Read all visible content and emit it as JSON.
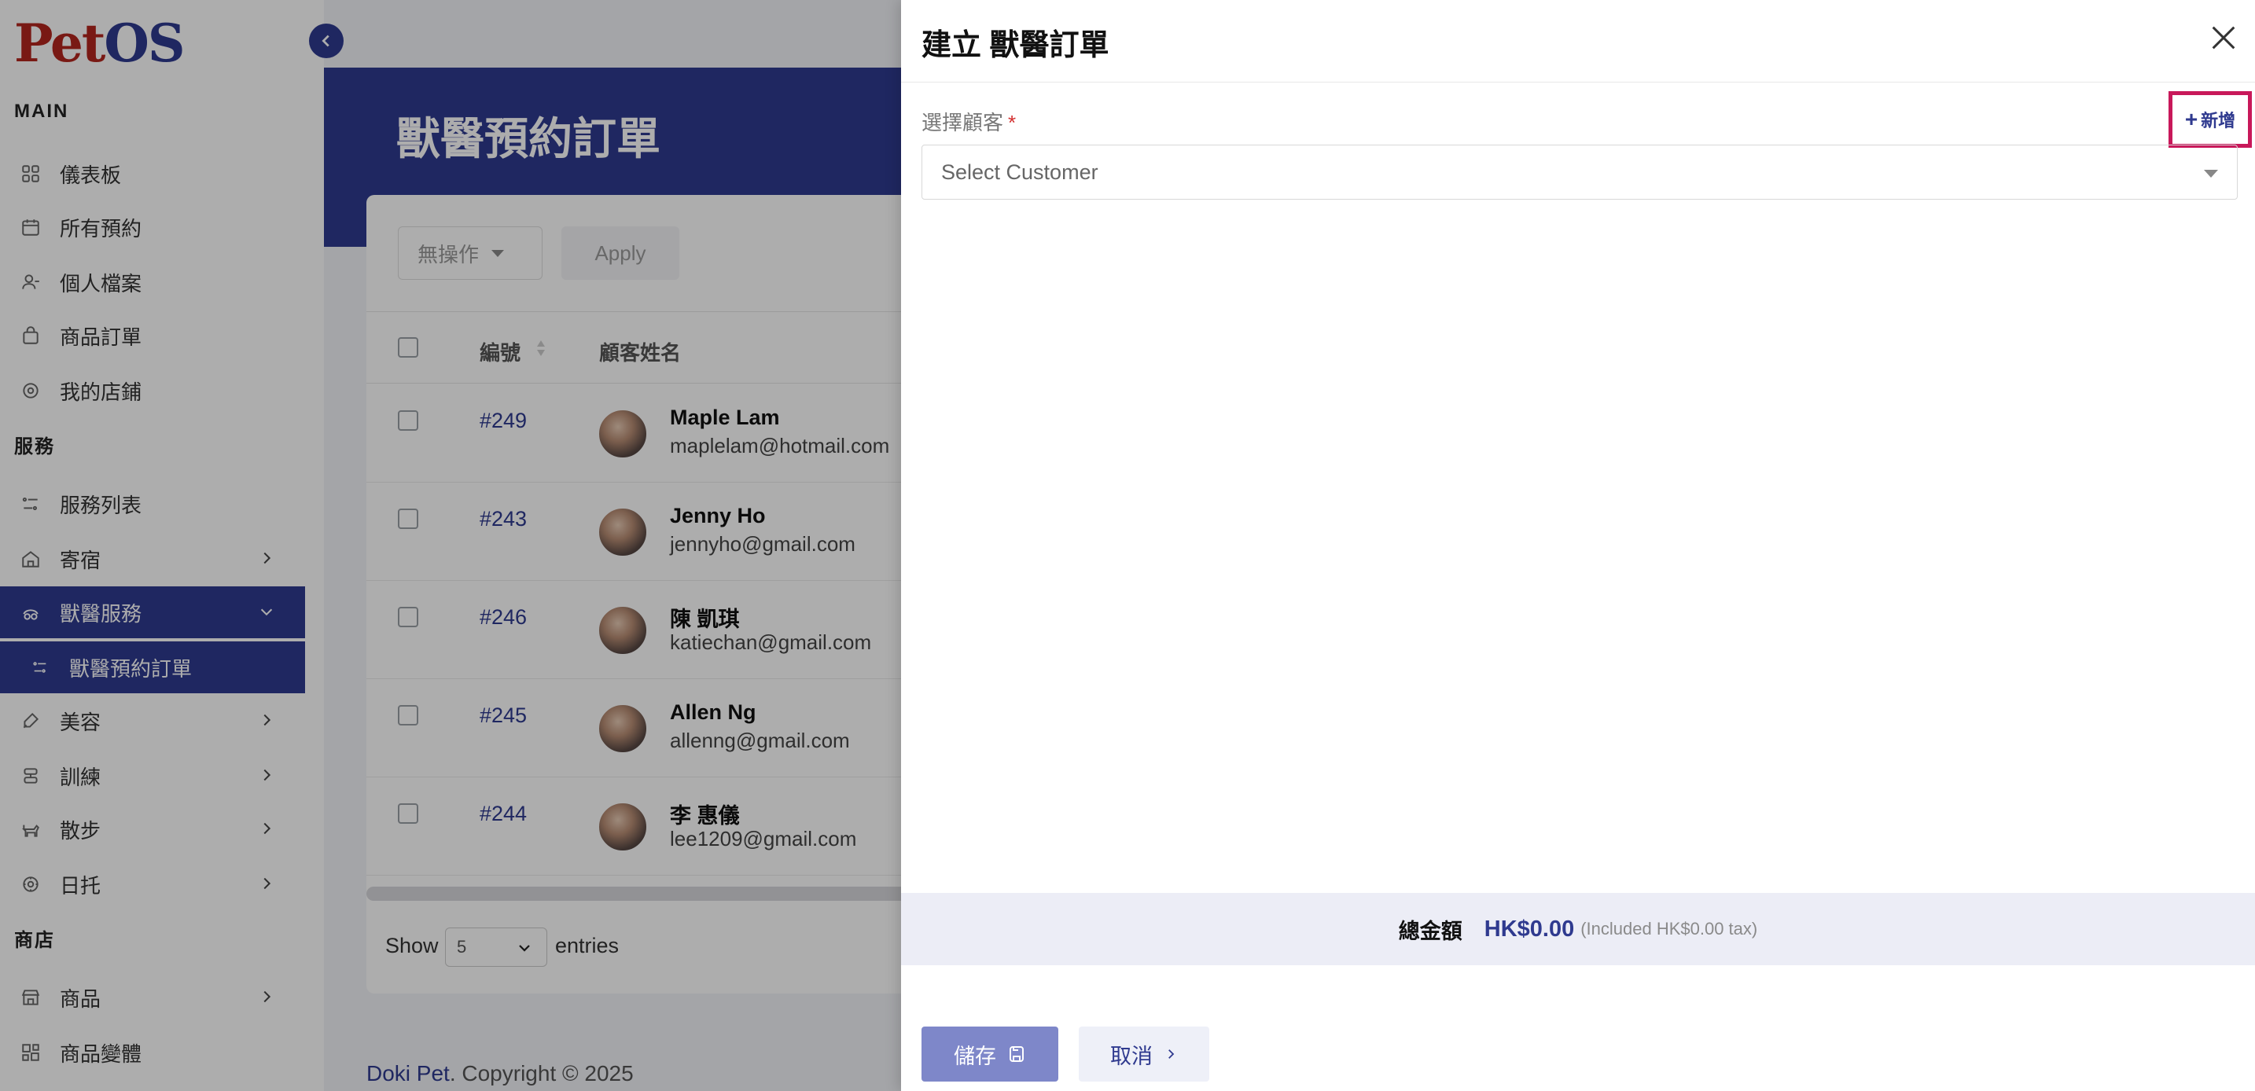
{
  "sidebar": {
    "logo_pet": "Pet",
    "logo_os": "OS",
    "sections": {
      "main": "MAIN",
      "services": "服務",
      "shop": "商店"
    },
    "items": [
      {
        "label": "儀表板",
        "icon": "dashboard-icon"
      },
      {
        "label": "所有預約",
        "icon": "calendar-icon"
      },
      {
        "label": "個人檔案",
        "icon": "user-icon"
      },
      {
        "label": "商品訂單",
        "icon": "bag-icon"
      },
      {
        "label": "我的店鋪",
        "icon": "store-icon"
      },
      {
        "label": "服務列表",
        "icon": "list-icon"
      },
      {
        "label": "寄宿",
        "icon": "home-icon"
      },
      {
        "label": "獸醫服務",
        "icon": "vet-icon"
      },
      {
        "label": "獸醫預約訂單",
        "icon": "list-icon"
      },
      {
        "label": "美容",
        "icon": "brush-icon"
      },
      {
        "label": "訓練",
        "icon": "training-icon"
      },
      {
        "label": "散步",
        "icon": "dog-icon"
      },
      {
        "label": "日托",
        "icon": "daycare-icon"
      },
      {
        "label": "商品",
        "icon": "shop-icon"
      },
      {
        "label": "商品變體",
        "icon": "variants-icon"
      }
    ]
  },
  "main": {
    "page_title": "獸醫預約訂單",
    "bulk_action": "無操作",
    "apply_label": "Apply",
    "columns": {
      "id": "編號",
      "customer": "顧客姓名"
    },
    "rows": [
      {
        "id": "#249",
        "name": "Maple Lam",
        "email": "maplelam@hotmail.com"
      },
      {
        "id": "#243",
        "name": "Jenny Ho",
        "email": "jennyho@gmail.com"
      },
      {
        "id": "#246",
        "name": "陳 凱琪",
        "email": "katiechan@gmail.com"
      },
      {
        "id": "#245",
        "name": "Allen Ng",
        "email": "allenng@gmail.com"
      },
      {
        "id": "#244",
        "name": "李 惠儀",
        "email": "lee1209@gmail.com"
      }
    ],
    "show_label": "Show",
    "entries_value": "5",
    "entries_label": "entries",
    "footer_brand": "Doki Pet",
    "footer_text": ". Copyright © 2025"
  },
  "drawer": {
    "title": "建立 獸醫訂單",
    "customer_label": "選擇顧客",
    "required_mark": "*",
    "add_new_label": "新增",
    "add_new_plus": "+",
    "customer_placeholder": "Select Customer",
    "total_label": "總金額",
    "total_amount": "HK$0.00",
    "total_tax": "(Included HK$0.00 tax)",
    "save_label": "儲存",
    "cancel_label": "取消"
  },
  "colors": {
    "primary": "#2f3a8f",
    "logo_red": "#b3261e",
    "highlight": "#c8185a",
    "save_button": "#7e87c9"
  }
}
